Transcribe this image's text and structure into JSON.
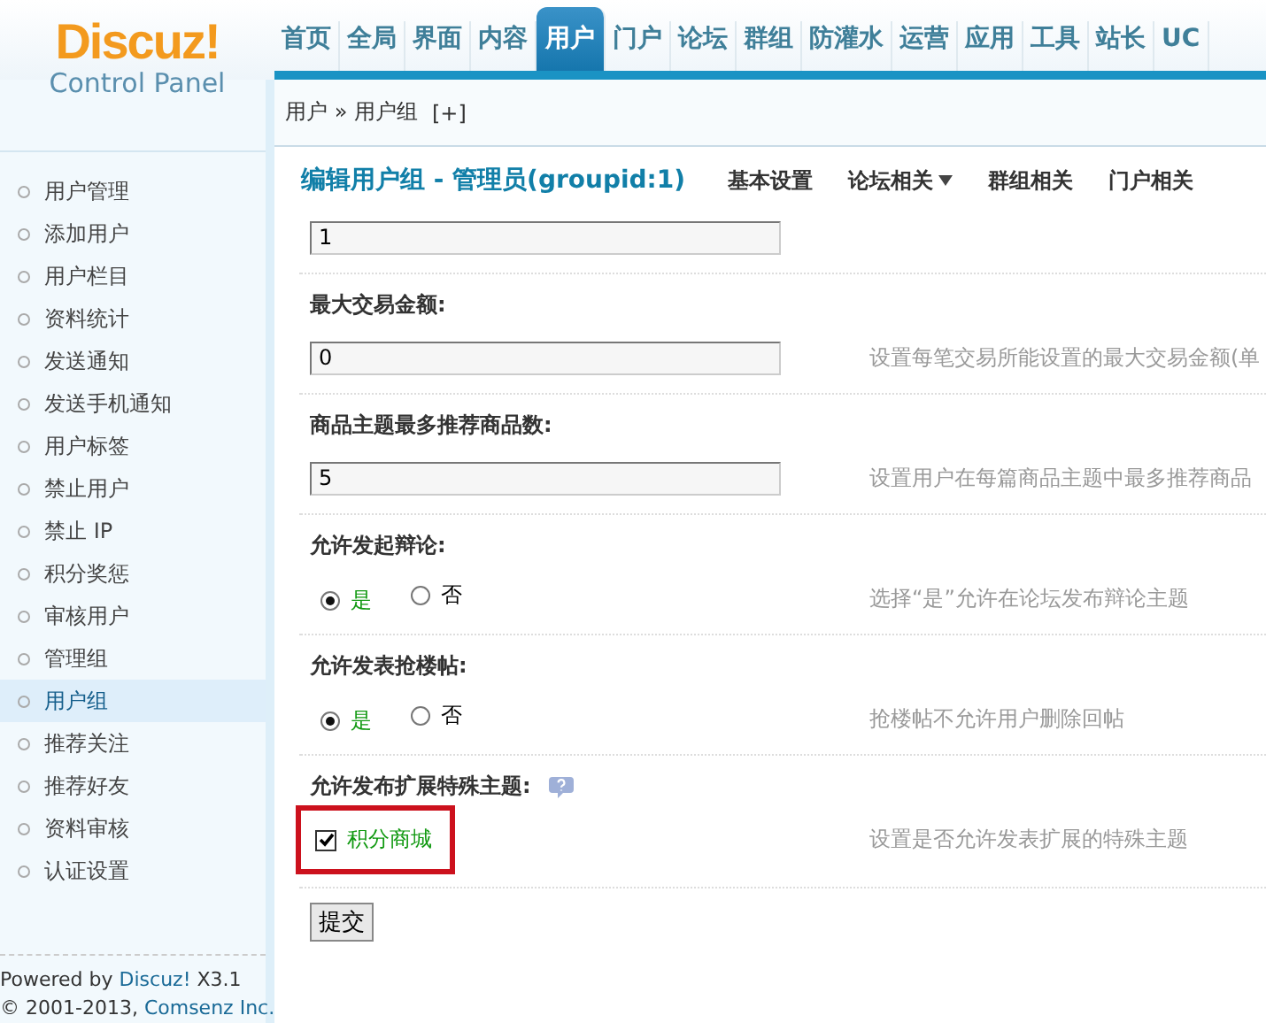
{
  "logo": {
    "title": "Discuz!",
    "subtitle": "Control Panel"
  },
  "nav": [
    {
      "label": "首页",
      "selected": false
    },
    {
      "label": "全局",
      "selected": false
    },
    {
      "label": "界面",
      "selected": false
    },
    {
      "label": "内容",
      "selected": false
    },
    {
      "label": "用户",
      "selected": true
    },
    {
      "label": "门户",
      "selected": false
    },
    {
      "label": "论坛",
      "selected": false
    },
    {
      "label": "群组",
      "selected": false
    },
    {
      "label": "防灌水",
      "selected": false
    },
    {
      "label": "运营",
      "selected": false
    },
    {
      "label": "应用",
      "selected": false
    },
    {
      "label": "工具",
      "selected": false
    },
    {
      "label": "站长",
      "selected": false
    },
    {
      "label": "UC",
      "selected": false
    }
  ],
  "breadcrumb": {
    "path": "用户 » 用户组",
    "add": "[+]"
  },
  "sidebar": {
    "items": [
      {
        "label": "用户管理",
        "selected": false
      },
      {
        "label": "添加用户",
        "selected": false
      },
      {
        "label": "用户栏目",
        "selected": false
      },
      {
        "label": "资料统计",
        "selected": false
      },
      {
        "label": "发送通知",
        "selected": false
      },
      {
        "label": "发送手机通知",
        "selected": false
      },
      {
        "label": "用户标签",
        "selected": false
      },
      {
        "label": "禁止用户",
        "selected": false
      },
      {
        "label": "禁止 IP",
        "selected": false
      },
      {
        "label": "积分奖惩",
        "selected": false
      },
      {
        "label": "审核用户",
        "selected": false
      },
      {
        "label": "管理组",
        "selected": false
      },
      {
        "label": "用户组",
        "selected": true
      },
      {
        "label": "推荐关注",
        "selected": false
      },
      {
        "label": "推荐好友",
        "selected": false
      },
      {
        "label": "资料审核",
        "selected": false
      },
      {
        "label": "认证设置",
        "selected": false
      }
    ],
    "footer": {
      "powered": "Powered by",
      "brand": "Discuz!",
      "version": "X3.1",
      "copyright": "© 2001-2013,",
      "company": "Comsenz Inc."
    }
  },
  "page": {
    "title": "编辑用户组 - 管理员(groupid:1)",
    "tabs": [
      {
        "label": "基本设置",
        "dropdown": false
      },
      {
        "label": "论坛相关",
        "dropdown": true
      },
      {
        "label": "群组相关",
        "dropdown": false
      },
      {
        "label": "门户相关",
        "dropdown": false
      }
    ]
  },
  "settings": [
    {
      "kind": "text",
      "value": "1"
    },
    {
      "kind": "text",
      "label": "最大交易金额:",
      "value": "0",
      "hint": "设置每笔交易所能设置的最大交易金额(单"
    },
    {
      "kind": "text",
      "label": "商品主题最多推荐商品数:",
      "value": "5",
      "hint": "设置用户在每篇商品主题中最多推荐商品"
    },
    {
      "kind": "radio",
      "label": "允许发起辩论:",
      "options": [
        {
          "label": "是",
          "selected": true
        },
        {
          "label": "否",
          "selected": false
        }
      ],
      "hint": "选择“是”允许在论坛发布辩论主题"
    },
    {
      "kind": "radio",
      "label": "允许发表抢楼帖:",
      "options": [
        {
          "label": "是",
          "selected": true
        },
        {
          "label": "否",
          "selected": false
        }
      ],
      "hint": "抢楼帖不允许用户删除回帖"
    },
    {
      "kind": "checkbox",
      "label": "允许发布扩展特殊主题:",
      "help": true,
      "highlighted": true,
      "options": [
        {
          "label": "积分商城",
          "checked": true
        }
      ],
      "hint": "设置是否允许发表扩展的特殊主题"
    }
  ],
  "submit": "提交"
}
